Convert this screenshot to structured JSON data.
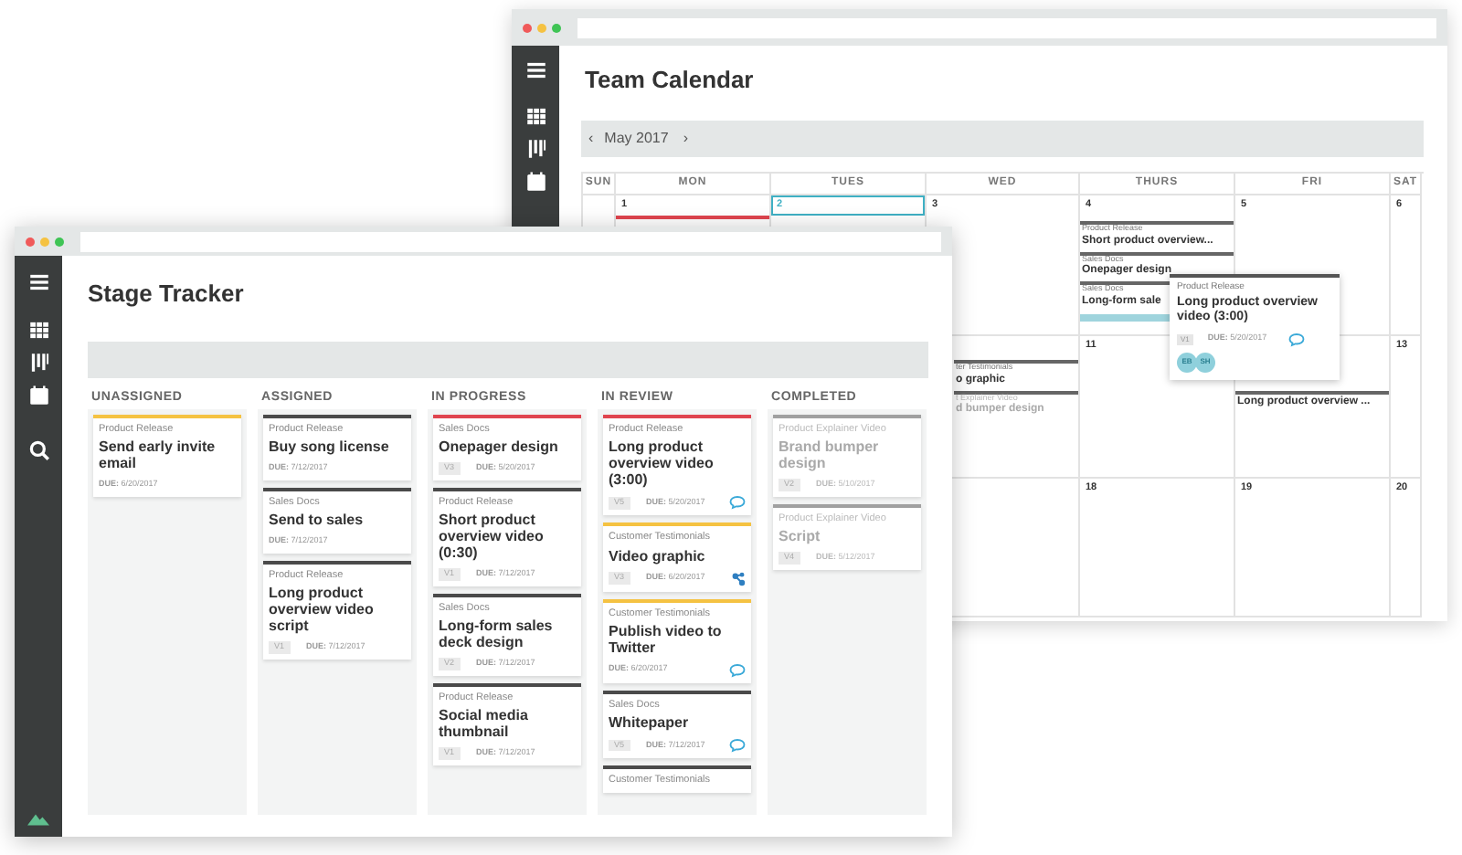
{
  "calendar_window": {
    "title": "Team Calendar",
    "month": "May 2017",
    "prev": "‹",
    "next": "›",
    "weekdays": [
      "SUN",
      "MON",
      "TUES",
      "WED",
      "THURS",
      "FRI",
      "SAT"
    ],
    "weeks": [
      {
        "mon": {
          "day": "1",
          "selected": false,
          "color": "#e0454f"
        },
        "tues": {
          "day": "2",
          "selected": true
        },
        "wed": {
          "day": "3",
          "selected": false
        },
        "thurs": {
          "day": "4",
          "selected": false,
          "events": [
            {
              "category": "Product Release",
              "title": "Short product overview...",
              "faded": false
            },
            {
              "category": "Sales Docs",
              "title": "Onepager design",
              "faded": false
            },
            {
              "category": "Sales Docs",
              "title": "Long-form sale",
              "faded": false
            }
          ],
          "more": true
        },
        "fri": {
          "day": "5",
          "selected": false
        },
        "sat": {
          "day": "6",
          "selected": false
        }
      },
      {
        "wed": {
          "events": [
            {
              "category": "ter Testimonials",
              "title": "o graphic",
              "faded": false
            },
            {
              "category": "t Explainer Video",
              "title": "d bumper design",
              "faded": true
            }
          ]
        },
        "thurs": {
          "day": "11",
          "selected": false
        },
        "fri": {
          "events": [
            {
              "title": "Long product overview ...",
              "faded": false
            }
          ]
        },
        "sat": {
          "day": "13",
          "selected": false
        }
      },
      {
        "thurs": {
          "day": "18",
          "selected": false
        },
        "fri": {
          "day": "19",
          "selected": false
        },
        "sat": {
          "day": "20",
          "selected": false
        }
      }
    ],
    "popup": {
      "category": "Product Release",
      "title": "Long product overview video (3:00)",
      "version": "V1",
      "due": "**DUE:** 5/20/2017",
      "avatars": [
        "EB",
        "SH"
      ]
    }
  },
  "tracker_window": {
    "title": "Stage Tracker",
    "columns": [
      {
        "label": "UNASSIGNED",
        "cards": [
          {
            "category": "Product Release",
            "title": "Send early invite email",
            "due": "**DUE:** 6/20/2017",
            "color": "#f5c242",
            "faded": false
          }
        ]
      },
      {
        "label": "ASSIGNED",
        "cards": [
          {
            "category": "Product Release",
            "title": "Buy song license",
            "due": "**DUE:** 7/12/2017",
            "color": "#4a4a4a",
            "faded": false
          },
          {
            "category": "Sales Docs",
            "title": "Send to sales",
            "due": "**DUE:** 7/12/2017",
            "color": "#4a4a4a",
            "faded": false
          },
          {
            "category": "Product Release",
            "title": "Long product overview video script",
            "version": "V1",
            "due": "**DUE:** 7/12/2017",
            "color": "#4a4a4a",
            "faded": false
          }
        ]
      },
      {
        "label": "IN PROGRESS",
        "cards": [
          {
            "category": "Sales Docs",
            "title": "Onepager design",
            "version": "V3",
            "due": "**DUE:** 5/20/2017",
            "color": "#e0454f",
            "faded": false
          },
          {
            "category": "Product Release",
            "title": "Short product overview video (0:30)",
            "version": "V1",
            "due": "**DUE:** 7/12/2017",
            "color": "#4a4a4a",
            "faded": false
          },
          {
            "category": "Sales Docs",
            "title": "Long-form sales deck design",
            "version": "V2",
            "due": "**DUE:** 7/12/2017",
            "color": "#4a4a4a",
            "faded": false
          },
          {
            "category": "Product Release",
            "title": "Social media thumbnail",
            "version": "V1",
            "due": "**DUE:** 7/12/2017",
            "color": "#4a4a4a",
            "faded": false
          }
        ]
      },
      {
        "label": "IN REVIEW",
        "cards": [
          {
            "category": "Product Release",
            "title": "Long product overview video (3:00)",
            "version": "V5",
            "due": "**DUE:** 5/20/2017",
            "kind": "comment",
            "color": "#e0454f",
            "faded": false
          },
          {
            "category": "Customer Testimonials",
            "title": "Video graphic",
            "version": "V3",
            "due": "**DUE:** 6/20/2017",
            "kind": "branch",
            "color": "#f5c242",
            "faded": false
          },
          {
            "category": "Customer Testimonials",
            "title": "Publish video to Twitter",
            "due": "**DUE:** 6/20/2017",
            "kind": "comment",
            "color": "#f5c242",
            "faded": false
          },
          {
            "category": "Sales Docs",
            "title": "Whitepaper",
            "version": "V5",
            "due": "**DUE:** 7/12/2017",
            "kind": "comment",
            "color": "#4a4a4a",
            "faded": false
          },
          {
            "category": "Customer Testimonials",
            "color": "#4a4a4a",
            "faded": false
          }
        ]
      },
      {
        "label": "COMPLETED",
        "cards": [
          {
            "category": "Product Explainer Video",
            "title": "Brand bumper design",
            "version": "V2",
            "due": "**DUE:** 5/10/2017",
            "color": "#a0a0a0",
            "faded": true
          },
          {
            "category": "Product Explainer Video",
            "title": "Script",
            "version": "V4",
            "due": "**DUE:** 5/12/2017",
            "color": "#a0a0a0",
            "faded": true
          }
        ]
      }
    ]
  }
}
